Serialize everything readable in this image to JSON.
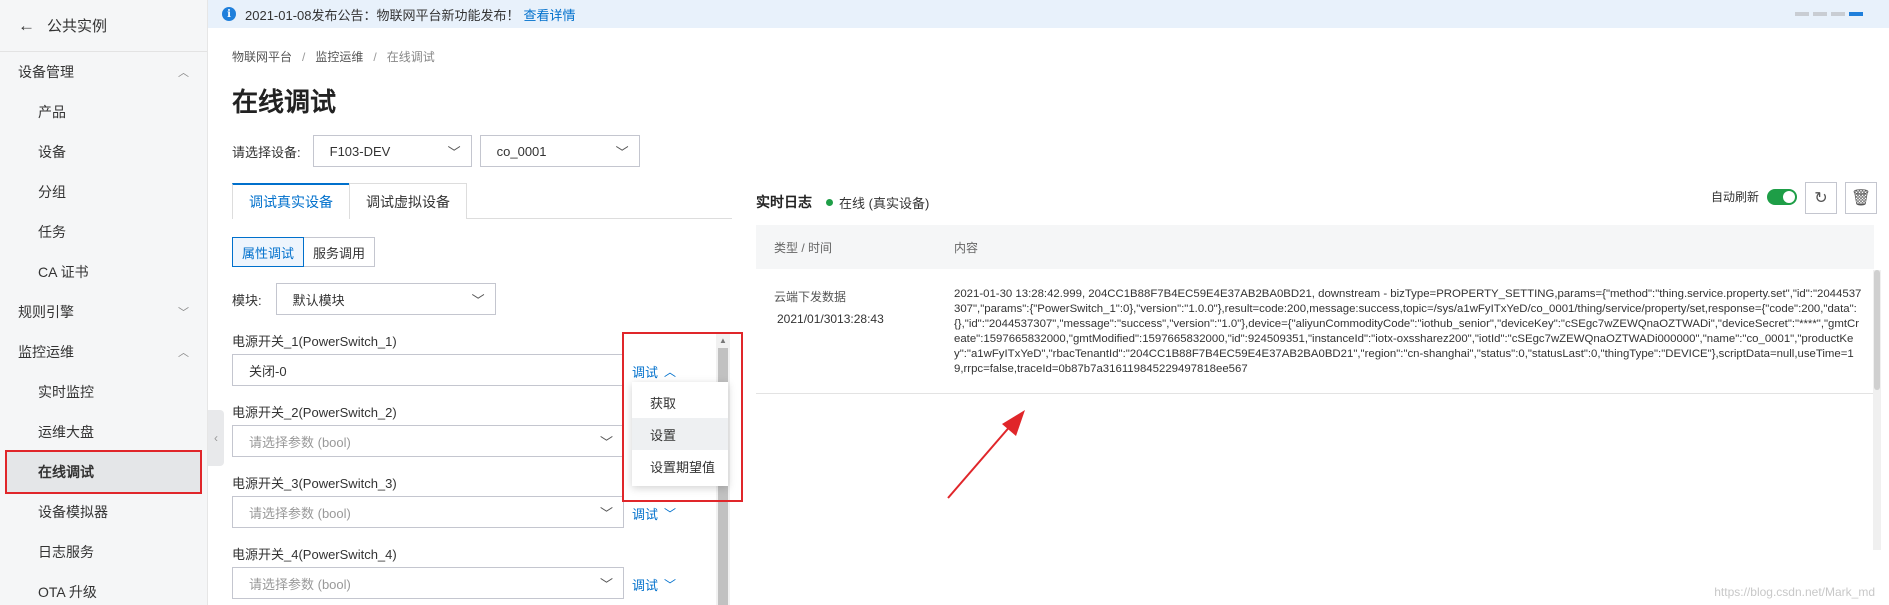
{
  "sidebar": {
    "back_label": "公共实例",
    "groups": [
      {
        "label": "设备管理",
        "items": [
          "产品",
          "设备",
          "分组",
          "任务",
          "CA 证书"
        ]
      },
      {
        "label": "规则引擎",
        "items": []
      },
      {
        "label": "监控运维",
        "items": [
          "实时监控",
          "运维大盘",
          "在线调试",
          "设备模拟器",
          "日志服务",
          "OTA 升级"
        ]
      }
    ],
    "active_item": "在线调试"
  },
  "notice": {
    "text": "2021-01-08发布公告：物联网平台新功能发布！",
    "link": "查看详情"
  },
  "breadcrumb": [
    "物联网平台",
    "监控运维",
    "在线调试"
  ],
  "page_title": "在线调试",
  "device_select": {
    "label": "请选择设备:",
    "product": "F103-DEV",
    "device": "co_0001"
  },
  "tabs": [
    "调试真实设备",
    "调试虚拟设备"
  ],
  "subtabs": [
    "属性调试",
    "服务调用"
  ],
  "module": {
    "label": "模块:",
    "value": "默认模块"
  },
  "switches": [
    {
      "label": "电源开关_1(PowerSwitch_1)",
      "value": "关闭-0",
      "placeholder": "",
      "debug": "调试"
    },
    {
      "label": "电源开关_2(PowerSwitch_2)",
      "value": "",
      "placeholder": "请选择参数 (bool)",
      "debug": "调试"
    },
    {
      "label": "电源开关_3(PowerSwitch_3)",
      "value": "",
      "placeholder": "请选择参数 (bool)",
      "debug": "调试"
    },
    {
      "label": "电源开关_4(PowerSwitch_4)",
      "value": "",
      "placeholder": "请选择参数 (bool)",
      "debug": "调试"
    }
  ],
  "debug_menu": [
    "获取",
    "设置",
    "设置期望值"
  ],
  "log": {
    "title": "实时日志",
    "status": "在线 (真实设备)",
    "auto_refresh": "自动刷新",
    "col_type_time": "类型 / 时间",
    "col_content": "内容",
    "rows": [
      {
        "type": "云端下发数据",
        "time": "2021/01/3013:28:43",
        "content": "2021-01-30 13:28:42.999, 204CC1B88F7B4EC59E4E37AB2BA0BD21, downstream - bizType=PROPERTY_SETTING,params={\"method\":\"thing.service.property.set\",\"id\":\"2044537307\",\"params\":{\"PowerSwitch_1\":0},\"version\":\"1.0.0\"},result=code:200,message:success,topic=/sys/a1wFyITxYeD/co_0001/thing/service/property/set,response={\"code\":200,\"data\":{},\"id\":\"2044537307\",\"message\":\"success\",\"version\":\"1.0\"},device={\"aliyunCommodityCode\":\"iothub_senior\",\"deviceKey\":\"cSEgc7wZEWQnaOZTWADi\",\"deviceSecret\":\"****\",\"gmtCreate\":1597665832000,\"gmtModified\":1597665832000,\"id\":924509351,\"instanceId\":\"iotx-oxssharez200\",\"iotId\":\"cSEgc7wZEWQnaOZTWADi000000\",\"name\":\"co_0001\",\"productKey\":\"a1wFyITxYeD\",\"rbacTenantId\":\"204CC1B88F7B4EC59E4E37AB2BA0BD21\",\"region\":\"cn-shanghai\",\"status\":0,\"statusLast\":0,\"thingType\":\"DEVICE\"},scriptData=null,useTime=19,rrpc=false,traceId=0b87b7a316119845229497818ee567"
      }
    ]
  },
  "watermark": "https://blog.csdn.net/Mark_md",
  "colors": {
    "accent": "#0070cc",
    "highlight": "#e0262a",
    "online": "#1e9e47"
  }
}
